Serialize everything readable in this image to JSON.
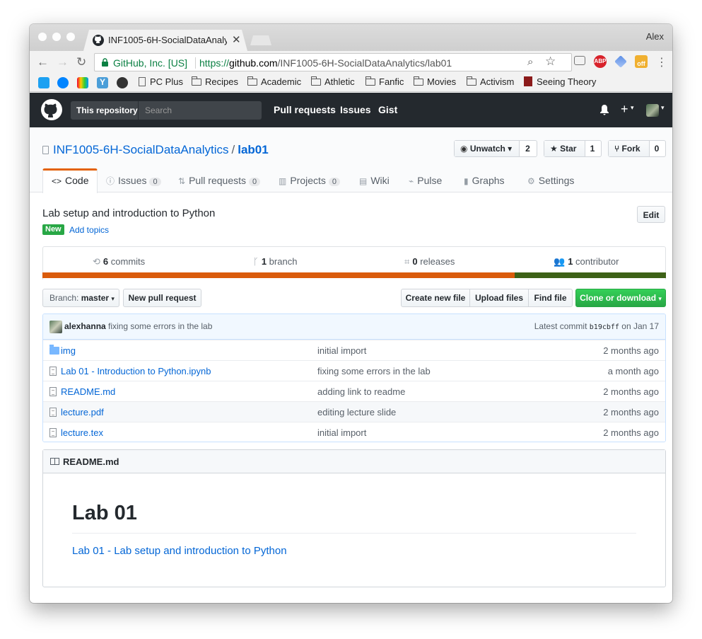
{
  "browser": {
    "tab_title": "INF1005-6H-SocialDataAnalytics",
    "profile_name": "Alex",
    "omnibox": {
      "secure_label": "GitHub, Inc. [US]",
      "url_scheme": "https://",
      "url_host": "github.com",
      "url_path": "/INF1005-6H-SocialDataAnalytics/lab01"
    },
    "bookmarks": [
      "PC Plus",
      "Recipes",
      "Academic",
      "Athletic",
      "Fanfic",
      "Movies",
      "Activism",
      "Seeing Theory"
    ],
    "extension_badge": "off"
  },
  "github_header": {
    "scope_label": "This repository",
    "search_placeholder": "Search",
    "nav": [
      "Pull requests",
      "Issues",
      "Gist"
    ]
  },
  "repo": {
    "owner": "INF1005-6H-SocialDataAnalytics",
    "separator": "/",
    "name": "lab01",
    "watch": {
      "label": "Unwatch",
      "count": "2"
    },
    "star": {
      "label": "Star",
      "count": "1"
    },
    "fork": {
      "label": "Fork",
      "count": "0"
    },
    "tabs": [
      {
        "label": "Code",
        "count": ""
      },
      {
        "label": "Issues",
        "count": "0"
      },
      {
        "label": "Pull requests",
        "count": "0"
      },
      {
        "label": "Projects",
        "count": "0"
      },
      {
        "label": "Wiki",
        "count": ""
      },
      {
        "label": "Pulse",
        "count": ""
      },
      {
        "label": "Graphs",
        "count": ""
      },
      {
        "label": "Settings",
        "count": ""
      }
    ],
    "description": "Lab setup and introduction to Python",
    "edit_label": "Edit",
    "new_badge": "New",
    "add_topics": "Add topics",
    "summary": {
      "commits_num": "6",
      "commits_label": "commits",
      "branches_num": "1",
      "branches_label": "branch",
      "releases_num": "0",
      "releases_label": "releases",
      "contributors_num": "1",
      "contributors_label": "contributor"
    },
    "languages": [
      {
        "color": "#DA5B0B",
        "share": 0.757
      },
      {
        "color": "#3D6117",
        "share": 0.243
      }
    ],
    "branch": {
      "prefix": "Branch:",
      "value": "master"
    },
    "buttons": {
      "new_pull_request": "New pull request",
      "create_new_file": "Create new file",
      "upload_files": "Upload files",
      "find_file": "Find file",
      "clone_download": "Clone or download"
    },
    "latest_commit": {
      "author": "alexhanna",
      "message": "fixing some errors in the lab",
      "prefix": "Latest commit",
      "sha": "b19cbff",
      "date_text": "on Jan 17"
    },
    "files": [
      {
        "name": "img",
        "type": "dir",
        "message": "initial import",
        "age": "2 months ago"
      },
      {
        "name": "Lab 01 - Introduction to Python.ipynb",
        "type": "file",
        "message": "fixing some errors in the lab",
        "age": "a month ago"
      },
      {
        "name": "README.md",
        "type": "file",
        "message": "adding link to readme",
        "age": "2 months ago"
      },
      {
        "name": "lecture.pdf",
        "type": "file",
        "message": "editing lecture slide",
        "age": "2 months ago"
      },
      {
        "name": "lecture.tex",
        "type": "file",
        "message": "initial import",
        "age": "2 months ago"
      }
    ],
    "readme": {
      "filename": "README.md",
      "heading": "Lab 01",
      "link": "Lab 01 - Lab setup and introduction to Python"
    }
  }
}
